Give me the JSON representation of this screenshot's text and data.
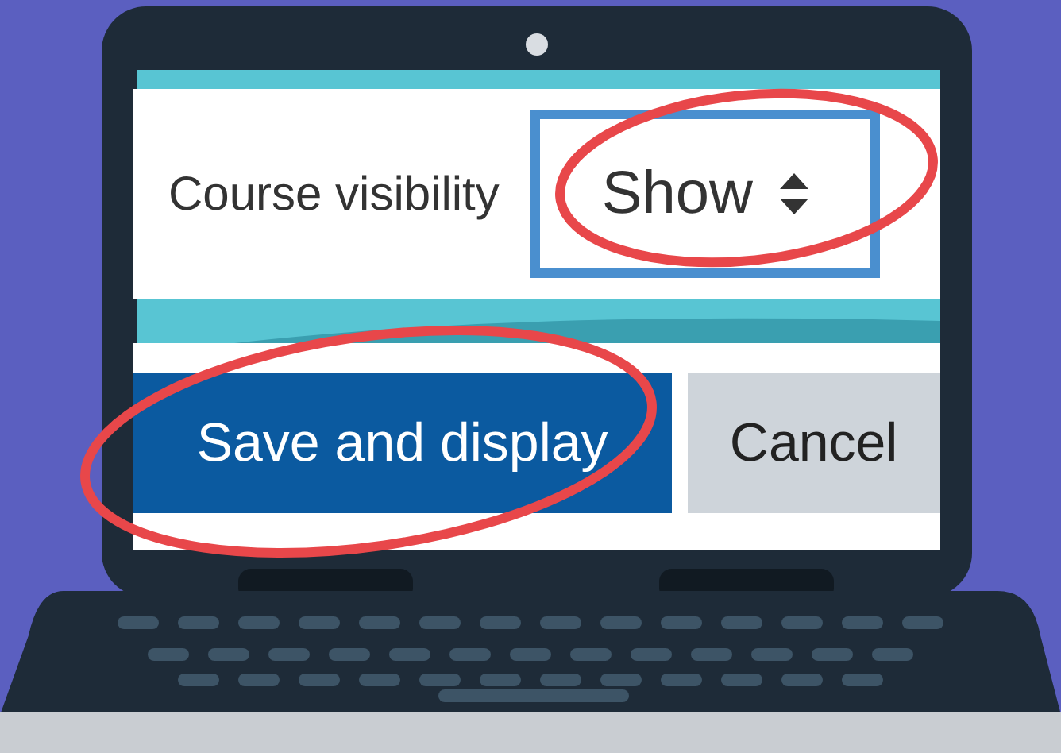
{
  "form": {
    "field_label": "Course visibility",
    "select": {
      "value": "Show"
    }
  },
  "buttons": [
    {
      "label": "Save and display",
      "kind": "primary"
    },
    {
      "label": "Cancel",
      "kind": "secondary"
    }
  ]
}
